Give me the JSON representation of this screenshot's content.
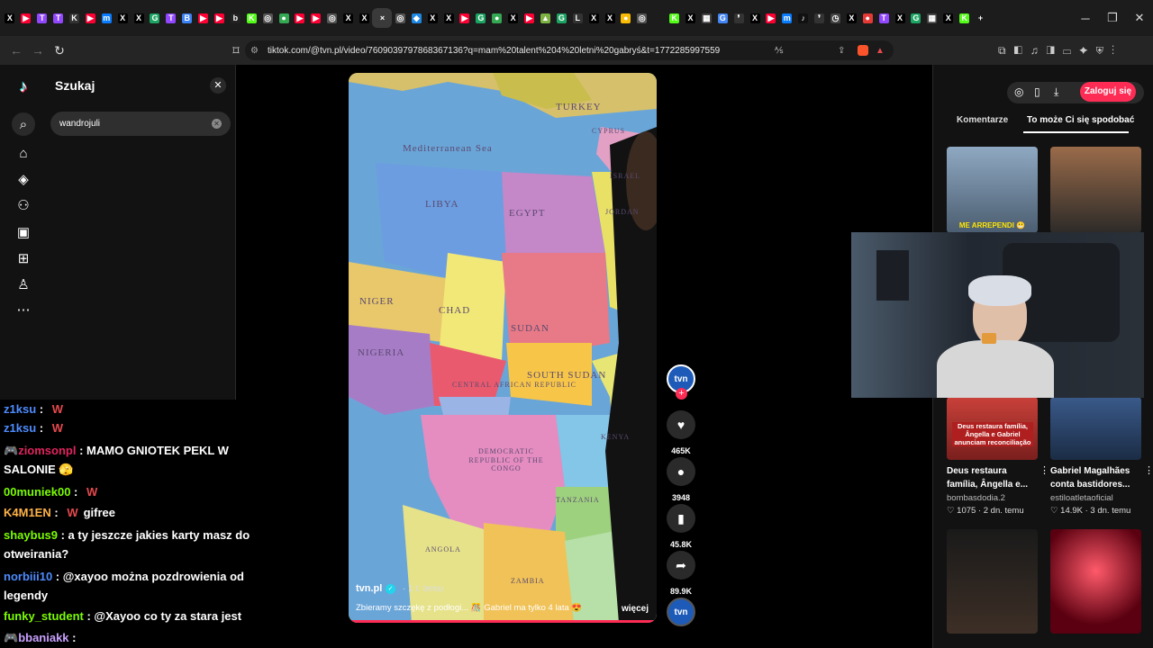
{
  "browser": {
    "tabs": [
      {
        "icon": "x-icon",
        "color": "#000",
        "glyph": "X"
      },
      {
        "icon": "youtube-icon",
        "color": "#ff0033",
        "glyph": "▶"
      },
      {
        "icon": "twitch-icon",
        "color": "#9146ff",
        "glyph": "T"
      },
      {
        "icon": "twitch-icon",
        "color": "#9146ff",
        "glyph": "T"
      },
      {
        "icon": "kick-icon",
        "color": "#333",
        "glyph": "K"
      },
      {
        "icon": "youtube-icon",
        "color": "#ff0033",
        "glyph": "▶"
      },
      {
        "icon": "messenger-icon",
        "color": "#0a7cff",
        "glyph": "m"
      },
      {
        "icon": "x-icon",
        "color": "#000",
        "glyph": "X"
      },
      {
        "icon": "x-icon",
        "color": "#000",
        "glyph": "X"
      },
      {
        "icon": "app-icon",
        "color": "#1ba462",
        "glyph": "G"
      },
      {
        "icon": "twitch-icon",
        "color": "#9146ff",
        "glyph": "T"
      },
      {
        "icon": "app-icon",
        "color": "#3b82f6",
        "glyph": "B"
      },
      {
        "icon": "youtube-icon",
        "color": "#ff0033",
        "glyph": "▶"
      },
      {
        "icon": "youtube-icon",
        "color": "#ff0033",
        "glyph": "▶"
      },
      {
        "icon": "bing-icon",
        "color": "#222",
        "glyph": "b"
      },
      {
        "icon": "kick-icon",
        "color": "#53fc18",
        "glyph": "K"
      },
      {
        "icon": "globe-icon",
        "color": "#555",
        "glyph": "◎"
      },
      {
        "icon": "maps-icon",
        "color": "#34a853",
        "glyph": "●"
      },
      {
        "icon": "youtube-icon",
        "color": "#ff0033",
        "glyph": "▶"
      },
      {
        "icon": "youtube-icon",
        "color": "#ff0033",
        "glyph": "▶"
      },
      {
        "icon": "globe-icon",
        "color": "#555",
        "glyph": "◎"
      },
      {
        "icon": "x-icon",
        "color": "#000",
        "glyph": "X"
      },
      {
        "icon": "x-icon",
        "color": "#000",
        "glyph": "X"
      },
      {
        "icon": "close-icon",
        "color": "#3a3a3a",
        "glyph": "×",
        "active": true
      },
      {
        "icon": "globe-icon",
        "color": "#555",
        "glyph": "◎"
      },
      {
        "icon": "drop-icon",
        "color": "#1e88e5",
        "glyph": "◆"
      },
      {
        "icon": "x-icon",
        "color": "#000",
        "glyph": "X"
      },
      {
        "icon": "x-icon",
        "color": "#000",
        "glyph": "X"
      },
      {
        "icon": "youtube-icon",
        "color": "#ff0033",
        "glyph": "▶"
      },
      {
        "icon": "app-icon",
        "color": "#1ba462",
        "glyph": "G"
      },
      {
        "icon": "maps-icon",
        "color": "#34a853",
        "glyph": "●"
      },
      {
        "icon": "x-icon",
        "color": "#000",
        "glyph": "X"
      },
      {
        "icon": "youtube-icon",
        "color": "#ff0033",
        "glyph": "▶"
      },
      {
        "icon": "chart-icon",
        "color": "#7cb342",
        "glyph": "▲"
      },
      {
        "icon": "app-icon",
        "color": "#1ba462",
        "glyph": "G"
      },
      {
        "icon": "letterbox-icon",
        "color": "#333",
        "glyph": "L"
      },
      {
        "icon": "x-icon",
        "color": "#000",
        "glyph": "X"
      },
      {
        "icon": "x-icon",
        "color": "#000",
        "glyph": "X"
      },
      {
        "icon": "chrome-icon",
        "color": "#fbbc04",
        "glyph": "●"
      },
      {
        "icon": "globe-icon",
        "color": "#555",
        "glyph": "◎"
      },
      {
        "icon": "blank-icon",
        "color": "#1c1c1c",
        "glyph": ""
      },
      {
        "icon": "kick-icon",
        "color": "#53fc18",
        "glyph": "K"
      },
      {
        "icon": "x-icon",
        "color": "#000",
        "glyph": "X"
      },
      {
        "icon": "grid-icon",
        "color": "#444",
        "glyph": "▦"
      },
      {
        "icon": "google-icon",
        "color": "#4285f4",
        "glyph": "G"
      },
      {
        "icon": "quote-icon",
        "color": "#333",
        "glyph": "❜"
      },
      {
        "icon": "x-icon",
        "color": "#000",
        "glyph": "X"
      },
      {
        "icon": "youtube-icon",
        "color": "#ff0033",
        "glyph": "▶"
      },
      {
        "icon": "messenger-icon",
        "color": "#0a7cff",
        "glyph": "m"
      },
      {
        "icon": "tiktok-icon",
        "color": "#111",
        "glyph": "♪"
      },
      {
        "icon": "quote-icon",
        "color": "#333",
        "glyph": "❜"
      },
      {
        "icon": "clock-icon",
        "color": "#444",
        "glyph": "◷"
      },
      {
        "icon": "x-icon",
        "color": "#000",
        "glyph": "X"
      },
      {
        "icon": "record-icon",
        "color": "#e53935",
        "glyph": "●"
      },
      {
        "icon": "twitch-icon",
        "color": "#9146ff",
        "glyph": "T"
      },
      {
        "icon": "x-icon",
        "color": "#000",
        "glyph": "X"
      },
      {
        "icon": "app-icon",
        "color": "#1ba462",
        "glyph": "G"
      },
      {
        "icon": "grid-icon",
        "color": "#444",
        "glyph": "▦"
      },
      {
        "icon": "x-icon",
        "color": "#000",
        "glyph": "X"
      },
      {
        "icon": "kick-icon",
        "color": "#53fc18",
        "glyph": "K"
      },
      {
        "icon": "new-tab-icon",
        "color": "#1c1c1c",
        "glyph": "+"
      }
    ],
    "url": "tiktok.com/@tvn.pl/video/7609039797868367136?q=mam%20talent%204%20letni%20gabryś&t=1772285997559"
  },
  "tiktok": {
    "search_title": "Szukaj",
    "search_value": "wandrojuli",
    "video": {
      "author": "tvn.pl",
      "time": "· 1 t. temu",
      "caption": "Zbieramy szczękę z podłogi... 🎊 Gabriel ma tylko 4 lata 😍",
      "more": "więcej",
      "map_labels": [
        "TURKEY",
        "Mediterranean Sea",
        "LIBYA",
        "EGYPT",
        "NIGER",
        "CHAD",
        "SUDAN",
        "NIGERIA",
        "SOUTH SUDAN",
        "CENTRAL AFRICAN REPUBLIC",
        "DEMOCRATIC REPUBLIC OF THE CONGO",
        "TANZANIA",
        "KENYA",
        "ANGOLA",
        "ZAMBIA",
        "CYPRUS",
        "ISRAEL",
        "JORDAN"
      ]
    },
    "actions": {
      "avatar_label": "tvn",
      "likes": "465K",
      "comments": "3948",
      "saves": "45.8K",
      "shares": "89.9K"
    },
    "right": {
      "login": "Zaloguj się",
      "tab_comments": "Komentarze",
      "tab_suggest": "To może Ci się spodobać",
      "videos": [
        {
          "overlay": "ME ARREPENDI 😬"
        },
        {
          "overlay": ""
        },
        {
          "overlay": "Deus restaura família, Ângella e Gabriel anunciam reconciliação",
          "title": "Deus restaura família, Ângella e...",
          "author": "bombasdodia.2",
          "stats": "♡ 1075 · 2 dn. temu"
        },
        {
          "overlay": "",
          "title": "Gabriel Magalhães conta bastidores...",
          "author": "estiloatletaoficial",
          "stats": "♡ 14.9K · 3 dn. temu"
        },
        {
          "overlay": ""
        },
        {
          "overlay": ""
        }
      ]
    }
  },
  "chat": [
    {
      "user": "z1ksu",
      "user_color": "#4e8cff",
      "sep": " : ",
      "msg": "",
      "emote": "W",
      "badge": ""
    },
    {
      "user": "z1ksu",
      "user_color": "#4e8cff",
      "sep": " : ",
      "msg": "",
      "emote": "W",
      "badge": ""
    },
    {
      "user": "ziomsonpl",
      "user_color": "#e0245e",
      "sep": " : ",
      "msg": "MAMO GNIOTEK PEKL W SALONIE 🫣",
      "emote": "",
      "badge": "🎮"
    },
    {
      "user": "00muniek00",
      "user_color": "#7CFC00",
      "sep": " : ",
      "msg": "",
      "emote": "W",
      "badge": ""
    },
    {
      "user": "K4M1EN",
      "user_color": "#ffb347",
      "sep": " : ",
      "msg": "gifree",
      "emote": "W",
      "badge": ""
    },
    {
      "user": "shaybus9",
      "user_color": "#7CFC00",
      "sep": " : ",
      "msg": "a ty jeszcze jakies karty masz do otweirania?",
      "emote": "",
      "badge": ""
    },
    {
      "user": "norbiii10",
      "user_color": "#4e8cff",
      "sep": " : ",
      "msg": "@xayoo można pozdrowienia od legendy",
      "emote": "",
      "badge": ""
    },
    {
      "user": "funky_student",
      "user_color": "#7CFC00",
      "sep": " : ",
      "msg": "@Xayoo co ty za stara jest",
      "emote": "",
      "badge": ""
    },
    {
      "user": "bbaniakk",
      "user_color": "#c9a0ff",
      "sep": " : ",
      "msg": "",
      "emote": "",
      "badge": "🎮"
    }
  ]
}
